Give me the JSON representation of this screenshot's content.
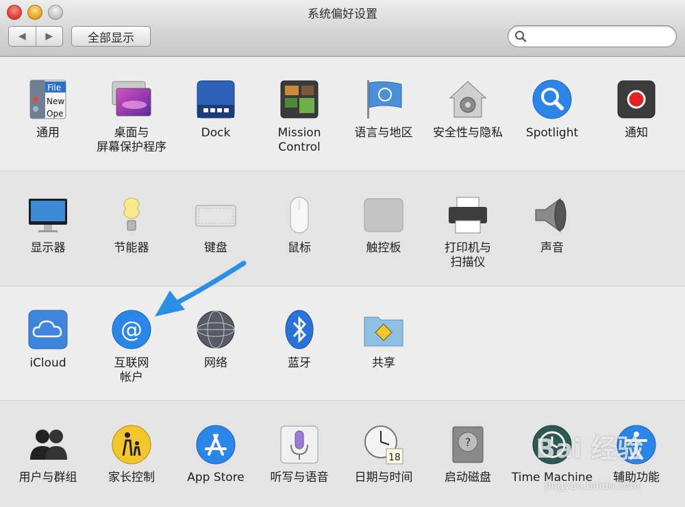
{
  "window": {
    "title": "系统偏好设置"
  },
  "toolbar": {
    "back_glyph": "◀",
    "forward_glyph": "▶",
    "show_all_label": "全部显示",
    "search_value": "",
    "search_placeholder": ""
  },
  "sections": [
    {
      "items": [
        {
          "label": "通用",
          "icon": "general-icon"
        },
        {
          "label": "桌面与\n屏幕保护程序",
          "icon": "desktop-screensaver-icon"
        },
        {
          "label": "Dock",
          "icon": "dock-icon"
        },
        {
          "label": "Mission\nControl",
          "icon": "mission-control-icon"
        },
        {
          "label": "语言与地区",
          "icon": "language-region-flag-icon"
        },
        {
          "label": "安全性与隐私",
          "icon": "security-privacy-house-icon"
        },
        {
          "label": "Spotlight",
          "icon": "spotlight-magnifier-icon"
        },
        {
          "label": "通知",
          "icon": "notifications-icon"
        }
      ]
    },
    {
      "items": [
        {
          "label": "显示器",
          "icon": "displays-monitor-icon"
        },
        {
          "label": "节能器",
          "icon": "energy-saver-bulb-icon"
        },
        {
          "label": "键盘",
          "icon": "keyboard-icon"
        },
        {
          "label": "鼠标",
          "icon": "mouse-icon"
        },
        {
          "label": "触控板",
          "icon": "trackpad-icon"
        },
        {
          "label": "打印机与\n扫描仪",
          "icon": "printer-icon"
        },
        {
          "label": "声音",
          "icon": "sound-speaker-icon"
        }
      ]
    },
    {
      "items": [
        {
          "label": "iCloud",
          "icon": "icloud-icon"
        },
        {
          "label": "互联网\n帐户",
          "icon": "internet-accounts-at-icon"
        },
        {
          "label": "网络",
          "icon": "network-globe-icon"
        },
        {
          "label": "蓝牙",
          "icon": "bluetooth-icon"
        },
        {
          "label": "共享",
          "icon": "sharing-folder-icon"
        }
      ]
    },
    {
      "items": [
        {
          "label": "用户与群组",
          "icon": "users-groups-icon"
        },
        {
          "label": "家长控制",
          "icon": "parental-controls-icon"
        },
        {
          "label": "App Store",
          "icon": "app-store-icon"
        },
        {
          "label": "听写与语音",
          "icon": "dictation-microphone-icon"
        },
        {
          "label": "日期与时间",
          "icon": "date-time-clock-icon"
        },
        {
          "label": "启动磁盘",
          "icon": "startup-disk-icon"
        },
        {
          "label": "Time Machine",
          "icon": "time-machine-icon"
        },
        {
          "label": "辅助功能",
          "icon": "accessibility-icon"
        }
      ]
    }
  ],
  "icon_text": {
    "general_file": "File",
    "general_new": "New",
    "general_open": "Ope",
    "calendar_day": "18"
  },
  "watermark": {
    "brand": "Bai 经验",
    "url": "jingyan.baidu.com"
  },
  "colors": {
    "accent_blue": "#2a86e8",
    "arrow_blue": "#2b8fe6"
  }
}
